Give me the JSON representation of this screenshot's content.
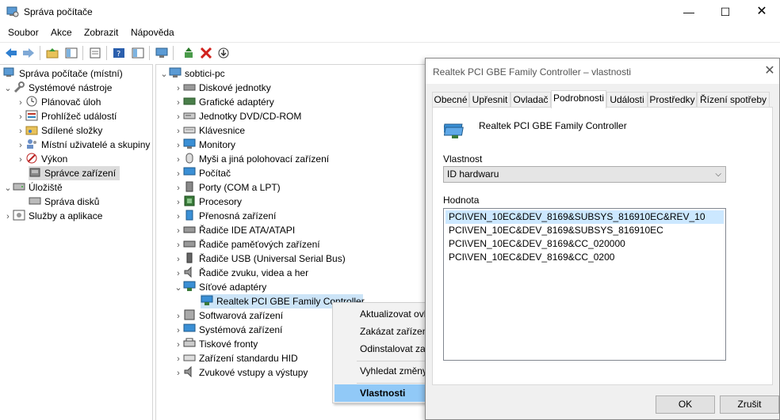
{
  "window": {
    "title": "Správa počítače",
    "minimize": "—",
    "maximize": "☐",
    "close": "✕"
  },
  "menubar": [
    "Soubor",
    "Akce",
    "Zobrazit",
    "Nápověda"
  ],
  "left_tree": {
    "root": "Správa počítače (místní)",
    "items": [
      {
        "label": "Systémové nástroje"
      },
      {
        "label": "Plánovač úloh"
      },
      {
        "label": "Prohlížeč událostí"
      },
      {
        "label": "Sdílené složky"
      },
      {
        "label": "Místní uživatelé a skupiny"
      },
      {
        "label": "Výkon"
      },
      {
        "label": "Správce zařízení"
      },
      {
        "label": "Úložiště"
      },
      {
        "label": "Správa disků"
      },
      {
        "label": "Služby a aplikace"
      }
    ]
  },
  "device_tree": {
    "root": "sobtici-pc",
    "items": [
      "Diskové jednotky",
      "Grafické adaptéry",
      "Jednotky DVD/CD-ROM",
      "Klávesnice",
      "Monitory",
      "Myši a jiná polohovací zařízení",
      "Počítač",
      "Porty (COM a LPT)",
      "Procesory",
      "Přenosná zařízení",
      "Řadiče IDE ATA/ATAPI",
      "Řadiče paměťových zařízení",
      "Řadiče USB (Universal Serial Bus)",
      "Řadiče zvuku, videa a her",
      "Síťové adaptéry",
      "Realtek PCI GBE Family Controller",
      "Softwarová zařízení",
      "Systémová zařízení",
      "Tiskové fronty",
      "Zařízení standardu HID",
      "Zvukové vstupy a výstupy"
    ]
  },
  "context_menu": {
    "items": [
      "Aktualizovat ovladač",
      "Zakázat zařízení",
      "Odinstalovat zařízení",
      "Vyhledat změny hardwaru",
      "Vlastnosti"
    ]
  },
  "dialog": {
    "title": "Realtek PCI GBE Family Controller – vlastnosti",
    "close": "✕",
    "tabs": [
      "Obecné",
      "Upřesnit",
      "Ovladač",
      "Podrobnosti",
      "Události",
      "Prostředky",
      "Řízení spotřeby"
    ],
    "active_tab": "Podrobnosti",
    "device_name": "Realtek PCI GBE Family Controller",
    "property_label": "Vlastnost",
    "property_value": "ID hardwaru",
    "value_label": "Hodnota",
    "values": [
      "PCI\\VEN_10EC&DEV_8169&SUBSYS_816910EC&REV_10",
      "PCI\\VEN_10EC&DEV_8169&SUBSYS_816910EC",
      "PCI\\VEN_10EC&DEV_8169&CC_020000",
      "PCI\\VEN_10EC&DEV_8169&CC_0200"
    ],
    "ok_label": "OK",
    "cancel_label": "Zrušit"
  },
  "colors": {
    "selection_blue": "#cce8ff",
    "menu_highlight": "#91c9f7",
    "dialog_bg": "#f0f0f0"
  }
}
